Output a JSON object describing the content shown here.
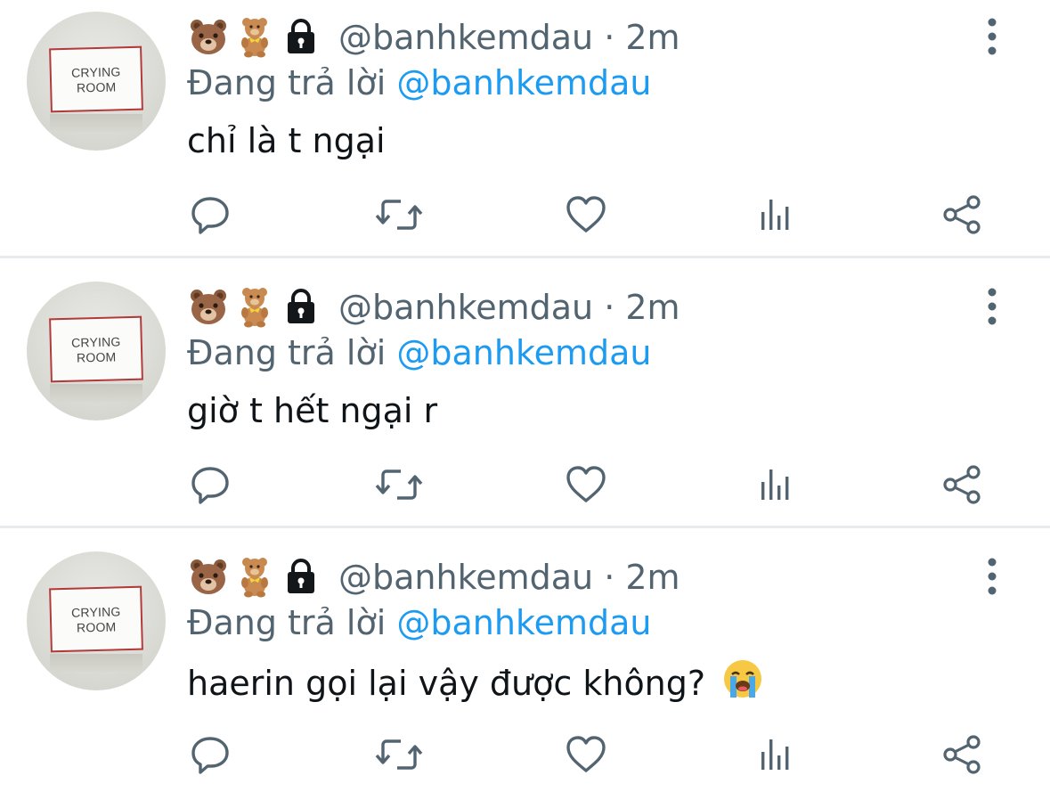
{
  "colors": {
    "secondary_text": "#536471",
    "link": "#1d9bf0",
    "primary_text": "#0f1419",
    "divider": "#e8ebee"
  },
  "avatar_sign": {
    "line1": "CRYING",
    "line2": "ROOM"
  },
  "tweets": [
    {
      "emojis": [
        "bear-face-icon",
        "teddy-bear-icon",
        "lock-icon"
      ],
      "handle": "@banhkemdau · 2m",
      "reply_prefix": "Đang trả lời",
      "reply_to": "@banhkemdau",
      "text": "chỉ là t ngại"
    },
    {
      "emojis": [
        "bear-face-icon",
        "teddy-bear-icon",
        "lock-icon"
      ],
      "handle": "@banhkemdau · 2m",
      "reply_prefix": "Đang trả lời",
      "reply_to": "@banhkemdau",
      "text": "giờ t hết ngại r"
    },
    {
      "emojis": [
        "bear-face-icon",
        "teddy-bear-icon",
        "lock-icon"
      ],
      "handle": "@banhkemdau · 2m",
      "reply_prefix": "Đang trả lời",
      "reply_to": "@banhkemdau",
      "text": "haerin gọi lại vậy được không?",
      "trailing_emoji": "loudly-crying-face-icon"
    }
  ],
  "actions": [
    "reply-icon",
    "retweet-icon",
    "like-icon",
    "views-icon",
    "share-icon"
  ]
}
